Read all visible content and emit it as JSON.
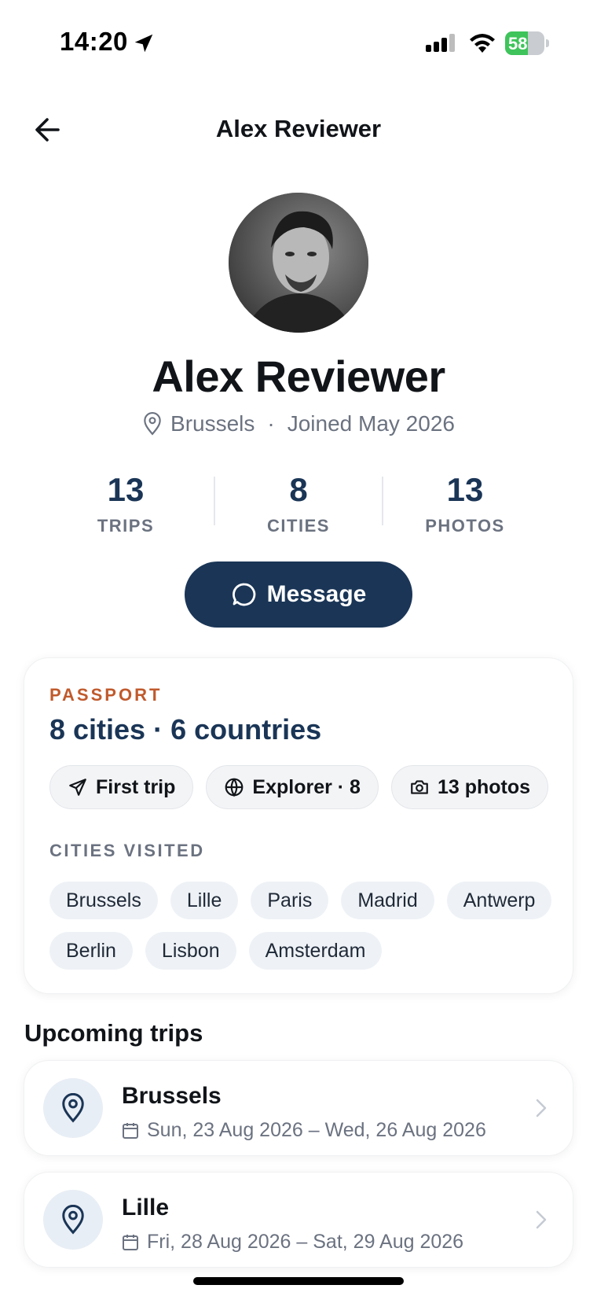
{
  "status_bar": {
    "time": "14:20",
    "battery_level": 58,
    "battery_text": "58",
    "icons": [
      "location-arrow-icon",
      "signal-icon",
      "wifi-icon",
      "battery-icon"
    ]
  },
  "nav": {
    "title": "Alex Reviewer",
    "back_icon": "arrow-left-icon"
  },
  "profile": {
    "name": "Alex Reviewer",
    "location": "Brussels",
    "separator": "·",
    "joined": "Joined May 2026"
  },
  "stats": [
    {
      "value": "13",
      "label": "TRIPS"
    },
    {
      "value": "8",
      "label": "CITIES"
    },
    {
      "value": "13",
      "label": "PHOTOS"
    }
  ],
  "message_button": {
    "label": "Message",
    "icon": "chat-bubble-icon"
  },
  "passport": {
    "label": "PASSPORT",
    "summary": "8 cities · 6 countries",
    "badges": [
      {
        "label": "First trip",
        "icon": "airplane-icon"
      },
      {
        "label": "Explorer · 8",
        "icon": "globe-icon"
      },
      {
        "label": "13 photos",
        "icon": "camera-icon"
      }
    ],
    "cities_label": "CITIES VISITED",
    "cities": [
      "Brussels",
      "Lille",
      "Paris",
      "Madrid",
      "Antwerp",
      "Berlin",
      "Lisbon",
      "Amsterdam"
    ]
  },
  "upcoming": {
    "title": "Upcoming trips",
    "trips": [
      {
        "city": "Brussels",
        "dates": "Sun, 23 Aug 2026 – Wed, 26 Aug 2026"
      },
      {
        "city": "Lille",
        "dates": "Fri, 28 Aug 2026 – Sat, 29 Aug 2026"
      }
    ]
  },
  "colors": {
    "primary": "#1a3556",
    "accent": "#c05a2c",
    "muted": "#6b7280",
    "battery": "#3ec45a"
  }
}
